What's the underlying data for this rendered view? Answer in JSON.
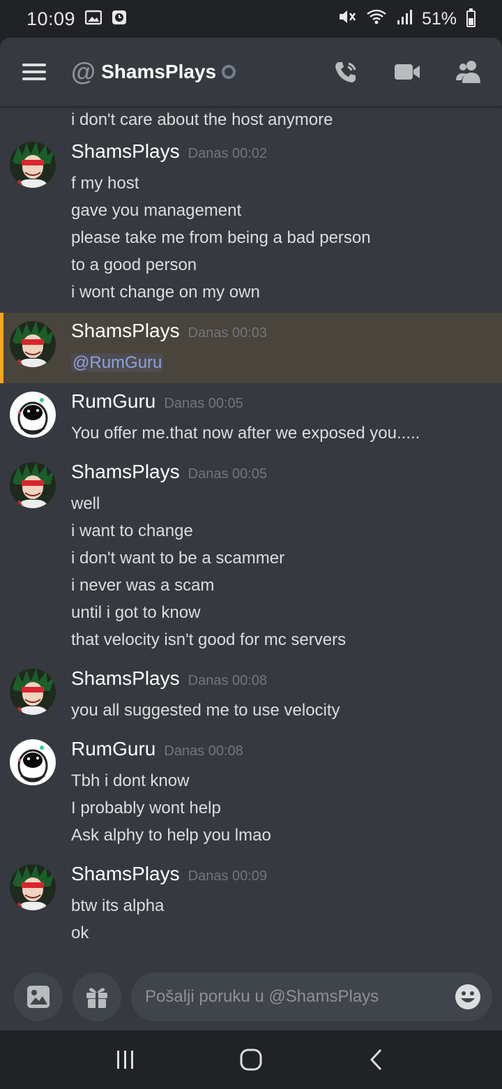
{
  "status_bar": {
    "time": "10:09",
    "battery_text": "51%",
    "battery_level": 0.51
  },
  "header": {
    "at_symbol": "@",
    "title": "ShamsPlays",
    "status": "offline"
  },
  "messages": {
    "first_continued_line": "i don't care about the host anymore",
    "groups": [
      {
        "author": "ShamsPlays",
        "time": "Danas 00:02",
        "avatar": "green-haired-character",
        "lines": [
          "f my host",
          "gave you management",
          "please take me from being a bad person",
          "to a good person",
          "i wont change on my own"
        ]
      },
      {
        "author": "ShamsPlays",
        "time": "Danas 00:03",
        "avatar": "green-haired-character",
        "mention": "@RumGuru",
        "highlighted": true
      },
      {
        "author": "RumGuru",
        "time": "Danas 00:05",
        "avatar": "astronaut",
        "lines": [
          "You offer me.that now after we exposed you....."
        ]
      },
      {
        "author": "ShamsPlays",
        "time": "Danas 00:05",
        "avatar": "green-haired-character",
        "lines": [
          "well",
          "i want to change",
          "i don't want to be a scammer",
          "i never was a scam",
          "until i got to know",
          "that velocity isn't good for mc servers"
        ]
      },
      {
        "author": "ShamsPlays",
        "time": "Danas 00:08",
        "avatar": "green-haired-character",
        "lines": [
          "you all suggested me to use velocity"
        ]
      },
      {
        "author": "RumGuru",
        "time": "Danas 00:08",
        "avatar": "astronaut",
        "lines": [
          "Tbh i dont know",
          "I probably wont help",
          "Ask alphy to help you lmao"
        ]
      },
      {
        "author": "ShamsPlays",
        "time": "Danas 00:09",
        "avatar": "green-haired-character",
        "lines": [
          "btw its alpha",
          "ok"
        ]
      }
    ]
  },
  "composer": {
    "placeholder": "Pošalji poruku u @ShamsPlays"
  },
  "icons": [
    "menu-icon",
    "call-icon",
    "video-icon",
    "members-icon",
    "image-icon",
    "gift-icon",
    "emoji-icon",
    "recent-apps-icon",
    "home-icon",
    "back-icon"
  ],
  "colors": {
    "background": "#36393f",
    "header_dark": "#202225",
    "mention_highlight": "#49443c",
    "mention_bar": "#faa81a",
    "mention_text": "#8ea1e1"
  }
}
